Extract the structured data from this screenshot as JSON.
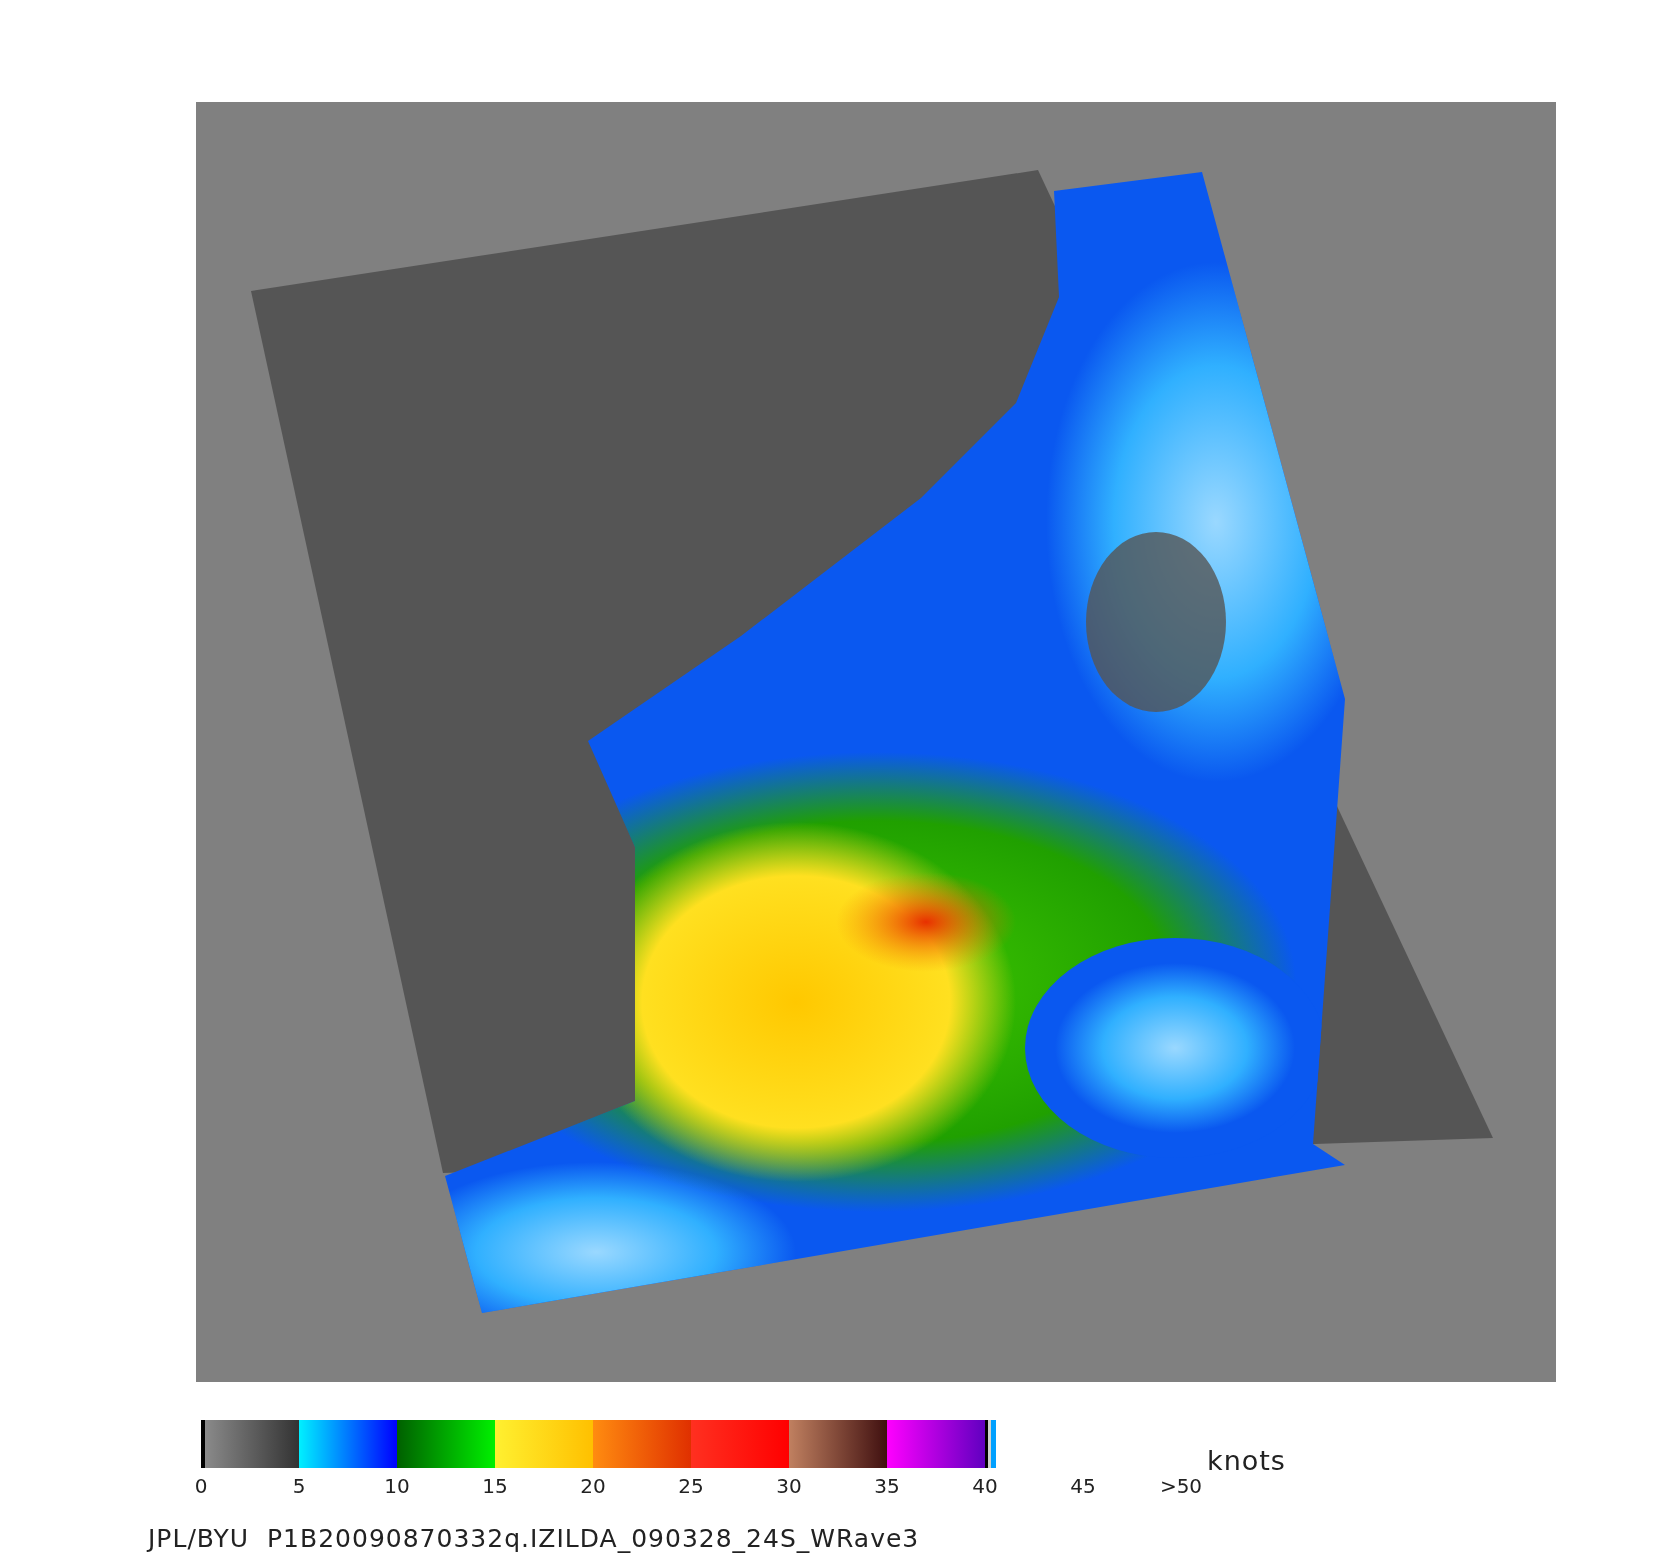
{
  "legend": {
    "ticks": [
      "0",
      "5",
      "10",
      "15",
      "20",
      "25",
      "30",
      "35",
      "40",
      "45",
      ">50"
    ],
    "unit": "knots"
  },
  "caption": "JPL/BYU  P1B20090870332q.IZILDA_090328_24S_WRave3"
}
